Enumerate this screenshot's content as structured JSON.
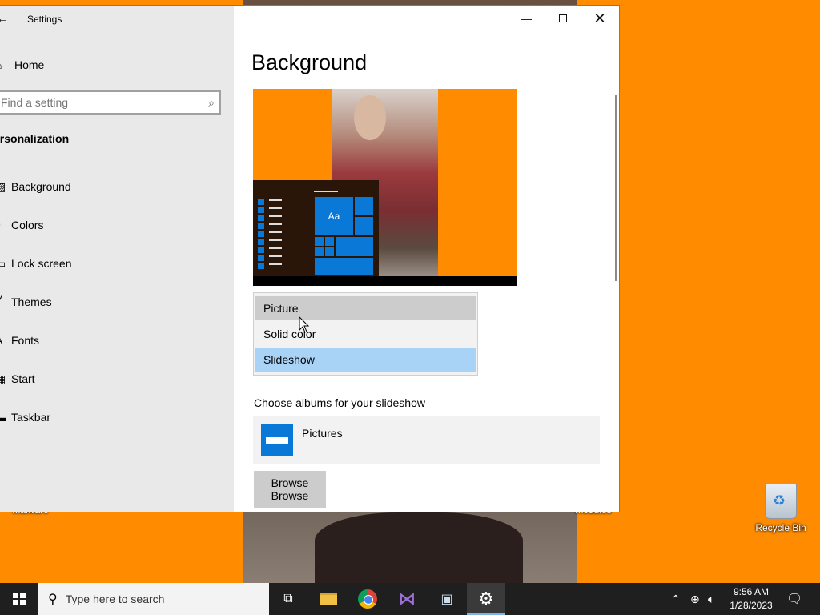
{
  "window": {
    "title": "Settings",
    "back_icon": "back-arrow-icon"
  },
  "sidebar": {
    "home_label": "Home",
    "search_placeholder": "Find a setting",
    "section": "ersonalization",
    "items": [
      {
        "label": "Background",
        "icon": "picture-icon"
      },
      {
        "label": "Colors",
        "icon": "palette-icon"
      },
      {
        "label": "Lock screen",
        "icon": "lock-screen-icon"
      },
      {
        "label": "Themes",
        "icon": "brush-icon"
      },
      {
        "label": "Fonts",
        "icon": "font-icon"
      },
      {
        "label": "Start",
        "icon": "start-icon"
      },
      {
        "label": "Taskbar",
        "icon": "taskbar-icon"
      }
    ]
  },
  "main": {
    "title": "Background",
    "preview_tile_label": "Aa",
    "dropdown": {
      "options": [
        "Picture",
        "Solid color",
        "Slideshow"
      ],
      "hovered": "Picture",
      "selected": "Slideshow"
    },
    "albums_label": "Choose albums for your slideshow",
    "album_name": "Pictures",
    "browse_line1": "Browse",
    "browse_line2": "Browse"
  },
  "desktop": {
    "icons": [
      {
        "label": "Malware"
      },
      {
        "label": "modules"
      },
      {
        "label": "Recycle Bin"
      }
    ]
  },
  "taskbar": {
    "search_placeholder": "Type here to search",
    "clock_time": "9:56 AM",
    "clock_date": "1/28/2023"
  },
  "colors": {
    "accent": "#0a78d7",
    "wallpaper": "#ff8c00",
    "selected_option": "#a8d2f6"
  }
}
